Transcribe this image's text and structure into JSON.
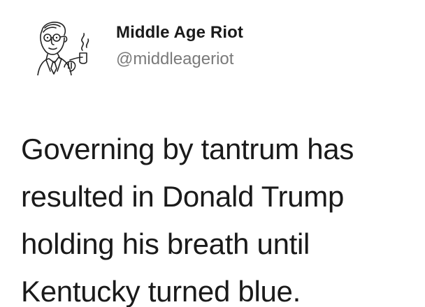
{
  "tweet": {
    "author": {
      "display_name": "Middle Age Riot",
      "handle": "@middleageriot",
      "avatar_icon": "vintage-man-with-pipe-illustration"
    },
    "text_lines": [
      "Governing by tantrum has",
      "resulted in Donald Trump",
      "holding his breath until",
      "Kentucky turned blue."
    ]
  },
  "colors": {
    "background": "#ffffff",
    "text": "#1a1a1a",
    "handle": "#7a7a7a"
  }
}
